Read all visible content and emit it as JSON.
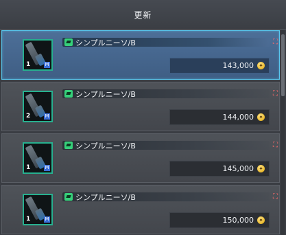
{
  "header": {
    "refresh_label": "更新"
  },
  "items": [
    {
      "name": "シンプルニーソ/B",
      "quantity": "1",
      "price": "143,000",
      "selected": true
    },
    {
      "name": "シンプルニーソ/B",
      "quantity": "2",
      "price": "144,000",
      "selected": false
    },
    {
      "name": "シンプルニーソ/B",
      "quantity": "1",
      "price": "145,000",
      "selected": false
    },
    {
      "name": "シンプルニーソ/B",
      "quantity": "1",
      "price": "150,000",
      "selected": false
    }
  ],
  "icons": {
    "category": "accessory-icon",
    "mark": "red-diamond-icon",
    "currency": "meseta-coin-icon",
    "badge": "M"
  },
  "colors": {
    "selected_border": "#59c8f0",
    "selected_bg": "#4d6f98",
    "thumb_border": "#27b08f",
    "category_green": "#36d07a"
  }
}
